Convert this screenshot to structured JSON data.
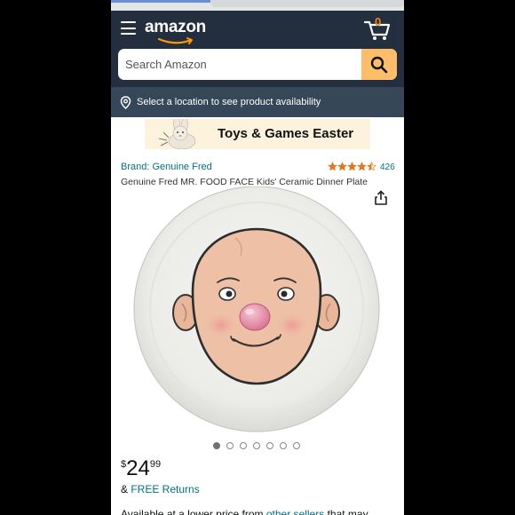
{
  "browser": {
    "progress": 0.35
  },
  "header": {
    "logo_text": "amazon",
    "cart_count": "0",
    "menu_icon": "hamburger-icon",
    "cart_icon": "cart-icon"
  },
  "search": {
    "placeholder": "Search Amazon",
    "icon": "search-icon",
    "accent": "#febd69"
  },
  "location": {
    "icon": "location-pin-icon",
    "text": "Select a location to see product availability"
  },
  "banner": {
    "text": "Toys & Games Easter",
    "image_icon": "bunny-plush-image"
  },
  "product": {
    "brand": "Brand: Genuine Fred",
    "rating": 4.5,
    "rating_max": 5,
    "rating_count": "426",
    "title": "Genuine Fred MR. FOOD FACE Kids' Ceramic Dinner Plate",
    "share_icon": "share-icon",
    "image_icon": "face-plate-image",
    "image_count": 7,
    "image_index": 1,
    "price_symbol": "$",
    "price_whole": "24",
    "price_fraction": "99",
    "returns_prefix": "& ",
    "returns_link": "FREE Returns",
    "availability_prefix": "Available at a lower price from ",
    "availability_link": "other sellers",
    "availability_suffix": " that may"
  },
  "colors": {
    "nav_bg": "#232f3e",
    "location_bg": "#37475a",
    "link": "#007185",
    "star": "#de7921",
    "cart_count": "#f08804"
  }
}
